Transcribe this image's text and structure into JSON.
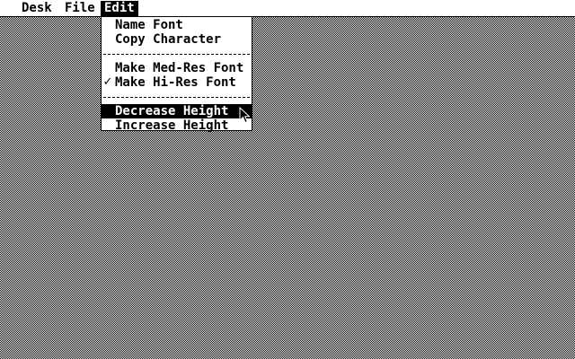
{
  "menubar": {
    "items": [
      {
        "label": "Desk"
      },
      {
        "label": "File"
      },
      {
        "label": "Edit"
      }
    ],
    "active": "Edit"
  },
  "edit_menu": {
    "items": [
      {
        "label": "Name Font",
        "checked": false,
        "highlighted": false
      },
      {
        "label": "Copy Character",
        "checked": false,
        "highlighted": false
      },
      {
        "label": "Make Med-Res Font",
        "checked": false,
        "highlighted": false
      },
      {
        "label": "Make Hi-Res Font",
        "checked": true,
        "highlighted": false
      },
      {
        "label": "Decrease Height",
        "checked": false,
        "highlighted": true
      },
      {
        "label": "Increase Height",
        "checked": false,
        "highlighted": false
      }
    ],
    "check_glyph": "✓"
  },
  "icons": {
    "pointer": "arrow-pointer-icon"
  },
  "colors": {
    "foreground": "#000000",
    "background": "#ffffff"
  }
}
